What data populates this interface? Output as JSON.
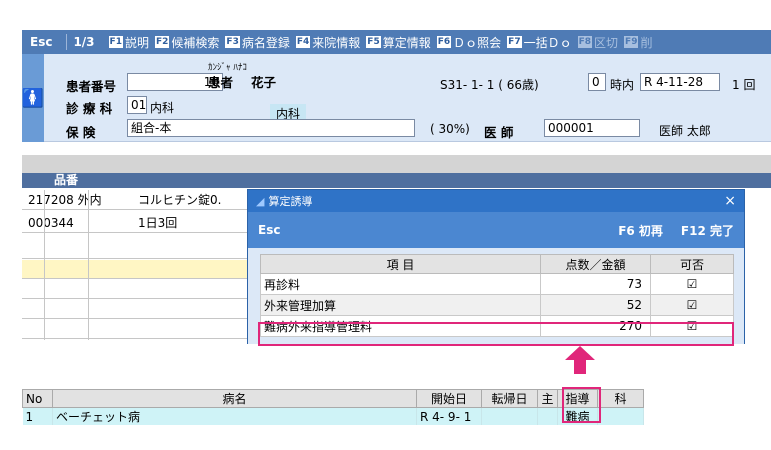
{
  "topbar": {
    "esc": "Esc",
    "page": "1/3",
    "keys": [
      {
        "k": "F1",
        "label": "説明"
      },
      {
        "k": "F2",
        "label": "候補検索"
      },
      {
        "k": "F3",
        "label": "病名登録"
      },
      {
        "k": "F4",
        "label": "来院情報"
      },
      {
        "k": "F5",
        "label": "算定情報"
      },
      {
        "k": "F6",
        "label": "Ｄｏ照会"
      },
      {
        "k": "F7",
        "label": "一括Ｄｏ"
      },
      {
        "k": "F8",
        "label": "区切"
      },
      {
        "k": "F9",
        "label": "削"
      }
    ]
  },
  "patient": {
    "id_label": "患者番号",
    "id": "10",
    "name_label": "患者",
    "kana": "ｶﾝｼﾞｬ ﾊﾅｺ",
    "name": "花子",
    "birth": "S31- 1- 1 ( 66歳)",
    "jinai_code": "0",
    "jinai": "時内",
    "date": "R 4-11-28",
    "extra": "1 回",
    "dept_label": "診 療 科",
    "dept_code": "01",
    "dept_name": "内科",
    "dept_badge": "内科",
    "ins_label": "保 険",
    "ins": "組合-本",
    "rate": "( 30%)",
    "doc_label": "医 師",
    "doc_code": "000001",
    "doc_name": "医師 太郎"
  },
  "grid": {
    "header": "品番",
    "rows": [
      {
        "code": "217208 外内",
        "name": "コルヒチン錠0."
      },
      {
        "code": "000344",
        "name": "1日3回"
      }
    ]
  },
  "dialog": {
    "title": "算定誘導",
    "close": "×",
    "esc": "Esc",
    "btn1": "F6 初再",
    "btn2": "F12 完了",
    "cols": [
      "項 目",
      "点数／金額",
      "可否"
    ],
    "rows": [
      {
        "item": "再診料",
        "pts": "73",
        "ok": "☑"
      },
      {
        "item": "外来管理加算",
        "pts": "52",
        "ok": "☑"
      },
      {
        "item": "難病外来指導管理料",
        "pts": "270",
        "ok": "☑"
      }
    ]
  },
  "disease": {
    "cols": [
      "No",
      "病名",
      "開始日",
      "転帰日",
      "主",
      "指導",
      "科"
    ],
    "rows": [
      {
        "no": "1",
        "name": "ベーチェット病",
        "start": "R 4- 9- 1",
        "end": "",
        "main": "",
        "guide": "難病",
        "dept": ""
      }
    ]
  },
  "colors": {
    "accent": "#4f7bb5",
    "highlight": "#e0267a"
  }
}
